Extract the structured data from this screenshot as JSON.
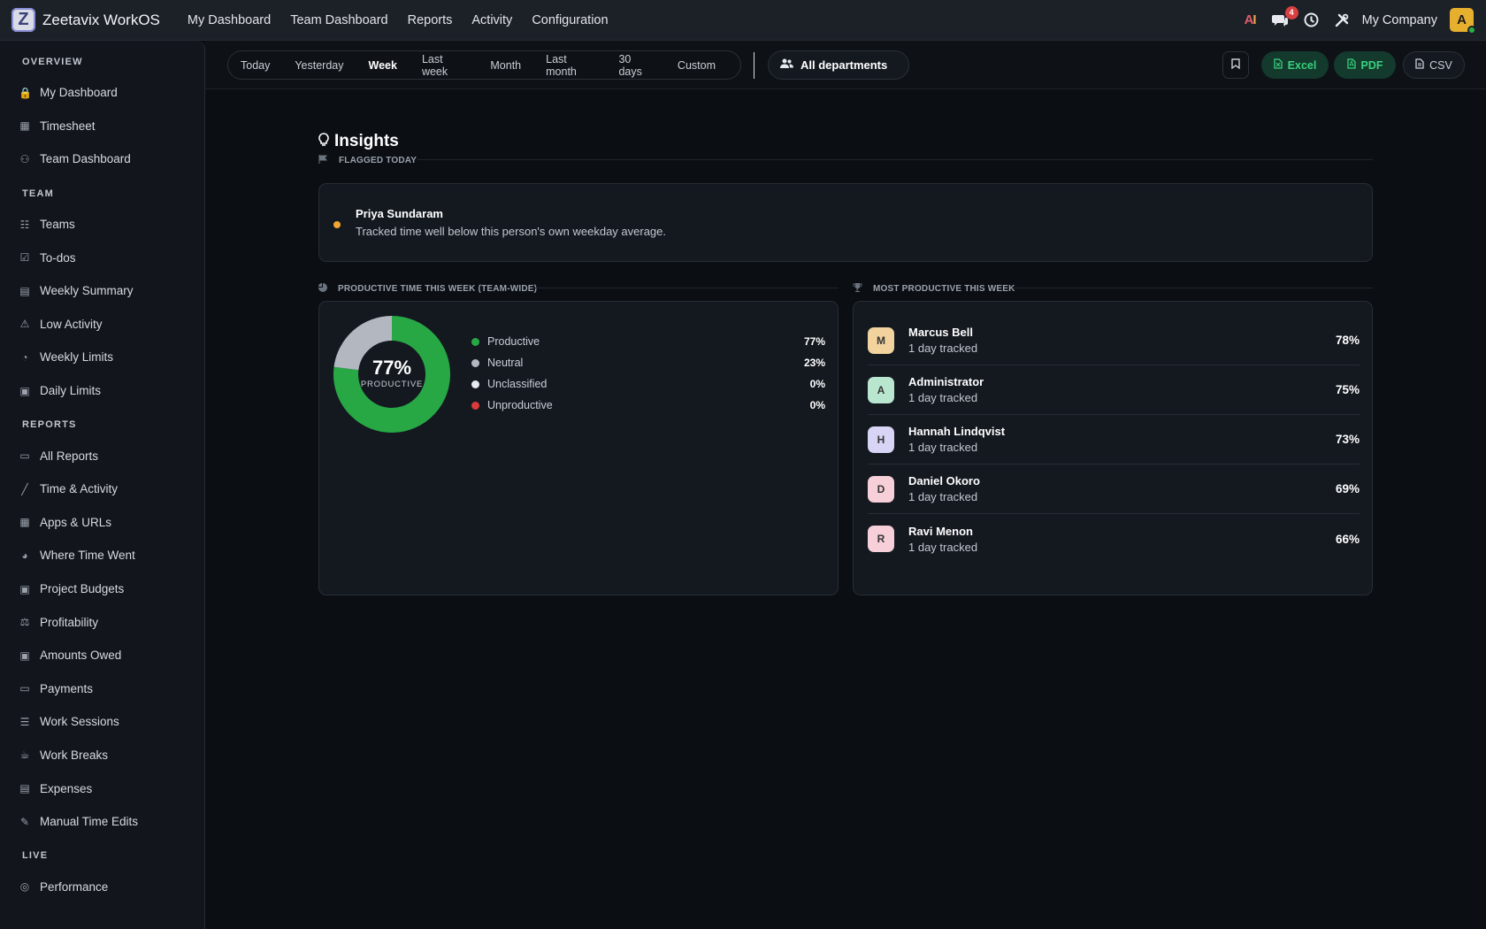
{
  "app": {
    "title": "Zeetavix WorkOS",
    "logo_letter": "Z"
  },
  "topnav": {
    "items": [
      "My Dashboard",
      "Team Dashboard",
      "Reports",
      "Activity",
      "Configuration"
    ],
    "ai_label_a": "A",
    "ai_label_i": "I",
    "notifications_count": "4",
    "company": "My Company",
    "avatar_letter": "A"
  },
  "sidebar": {
    "sections": [
      {
        "title": "OVERVIEW",
        "items": [
          {
            "label": "My Dashboard",
            "icon": "lock-icon"
          },
          {
            "label": "Timesheet",
            "icon": "calendar-icon"
          },
          {
            "label": "Team Dashboard",
            "icon": "users-icon"
          }
        ]
      },
      {
        "title": "TEAM",
        "items": [
          {
            "label": "Teams",
            "icon": "sitemap-icon"
          },
          {
            "label": "To-dos",
            "icon": "checkbox-icon"
          },
          {
            "label": "Weekly Summary",
            "icon": "table-icon"
          },
          {
            "label": "Low Activity",
            "icon": "warning-icon"
          },
          {
            "label": "Weekly Limits",
            "icon": "gauge-icon"
          },
          {
            "label": "Daily Limits",
            "icon": "calendar-check-icon"
          }
        ]
      },
      {
        "title": "REPORTS",
        "items": [
          {
            "label": "All Reports",
            "icon": "folder-icon"
          },
          {
            "label": "Time & Activity",
            "icon": "line-chart-icon"
          },
          {
            "label": "Apps & URLs",
            "icon": "grid-icon"
          },
          {
            "label": "Where Time Went",
            "icon": "pie-icon"
          },
          {
            "label": "Project Budgets",
            "icon": "briefcase-icon"
          },
          {
            "label": "Profitability",
            "icon": "scale-icon"
          },
          {
            "label": "Amounts Owed",
            "icon": "money-icon"
          },
          {
            "label": "Payments",
            "icon": "card-icon"
          },
          {
            "label": "Work Sessions",
            "icon": "list-icon"
          },
          {
            "label": "Work Breaks",
            "icon": "coffee-icon"
          },
          {
            "label": "Expenses",
            "icon": "receipt-icon"
          },
          {
            "label": "Manual Time Edits",
            "icon": "edit-icon"
          }
        ]
      },
      {
        "title": "LIVE",
        "items": [
          {
            "label": "Performance",
            "icon": "target-icon"
          }
        ]
      }
    ]
  },
  "filters": {
    "ranges": [
      "Today",
      "Yesterday",
      "Week",
      "Last week",
      "Month",
      "Last month",
      "30 days",
      "Custom"
    ],
    "active_range": "Week",
    "department": "All departments",
    "excel_label": "Excel",
    "pdf_label": "PDF",
    "csv_label": "CSV"
  },
  "insights": {
    "title": "Insights",
    "flagged_label": "FLAGGED TODAY",
    "flagged": {
      "name": "Priya Sundaram",
      "description": "Tracked time well below this person's own weekday average."
    },
    "productive_label": "PRODUCTIVE TIME THIS WEEK (TEAM-WIDE)",
    "donut_pct": "77%",
    "donut_sub": "PRODUCTIVE",
    "top_label": "MOST PRODUCTIVE THIS WEEK"
  },
  "chart_data": {
    "type": "pie",
    "categories": [
      "Productive",
      "Neutral",
      "Unclassified",
      "Unproductive"
    ],
    "values": [
      77,
      23,
      0,
      0
    ],
    "value_labels": [
      "77%",
      "23%",
      "0%",
      "0%"
    ],
    "colors": [
      "#27a845",
      "#b3b7c0",
      "#e8eaee",
      "#d93a3a"
    ]
  },
  "top_people": [
    {
      "initial": "M",
      "name": "Marcus Bell",
      "sub": "1 day tracked",
      "pct": "78%",
      "color": "#f2d39e"
    },
    {
      "initial": "A",
      "name": "Administrator",
      "sub": "1 day tracked",
      "pct": "75%",
      "color": "#b9e6cf"
    },
    {
      "initial": "H",
      "name": "Hannah Lindqvist",
      "sub": "1 day tracked",
      "pct": "73%",
      "color": "#d8d4f5"
    },
    {
      "initial": "D",
      "name": "Daniel Okoro",
      "sub": "1 day tracked",
      "pct": "69%",
      "color": "#f6cfd9"
    },
    {
      "initial": "R",
      "name": "Ravi Menon",
      "sub": "1 day tracked",
      "pct": "66%",
      "color": "#f6cfd9"
    }
  ]
}
